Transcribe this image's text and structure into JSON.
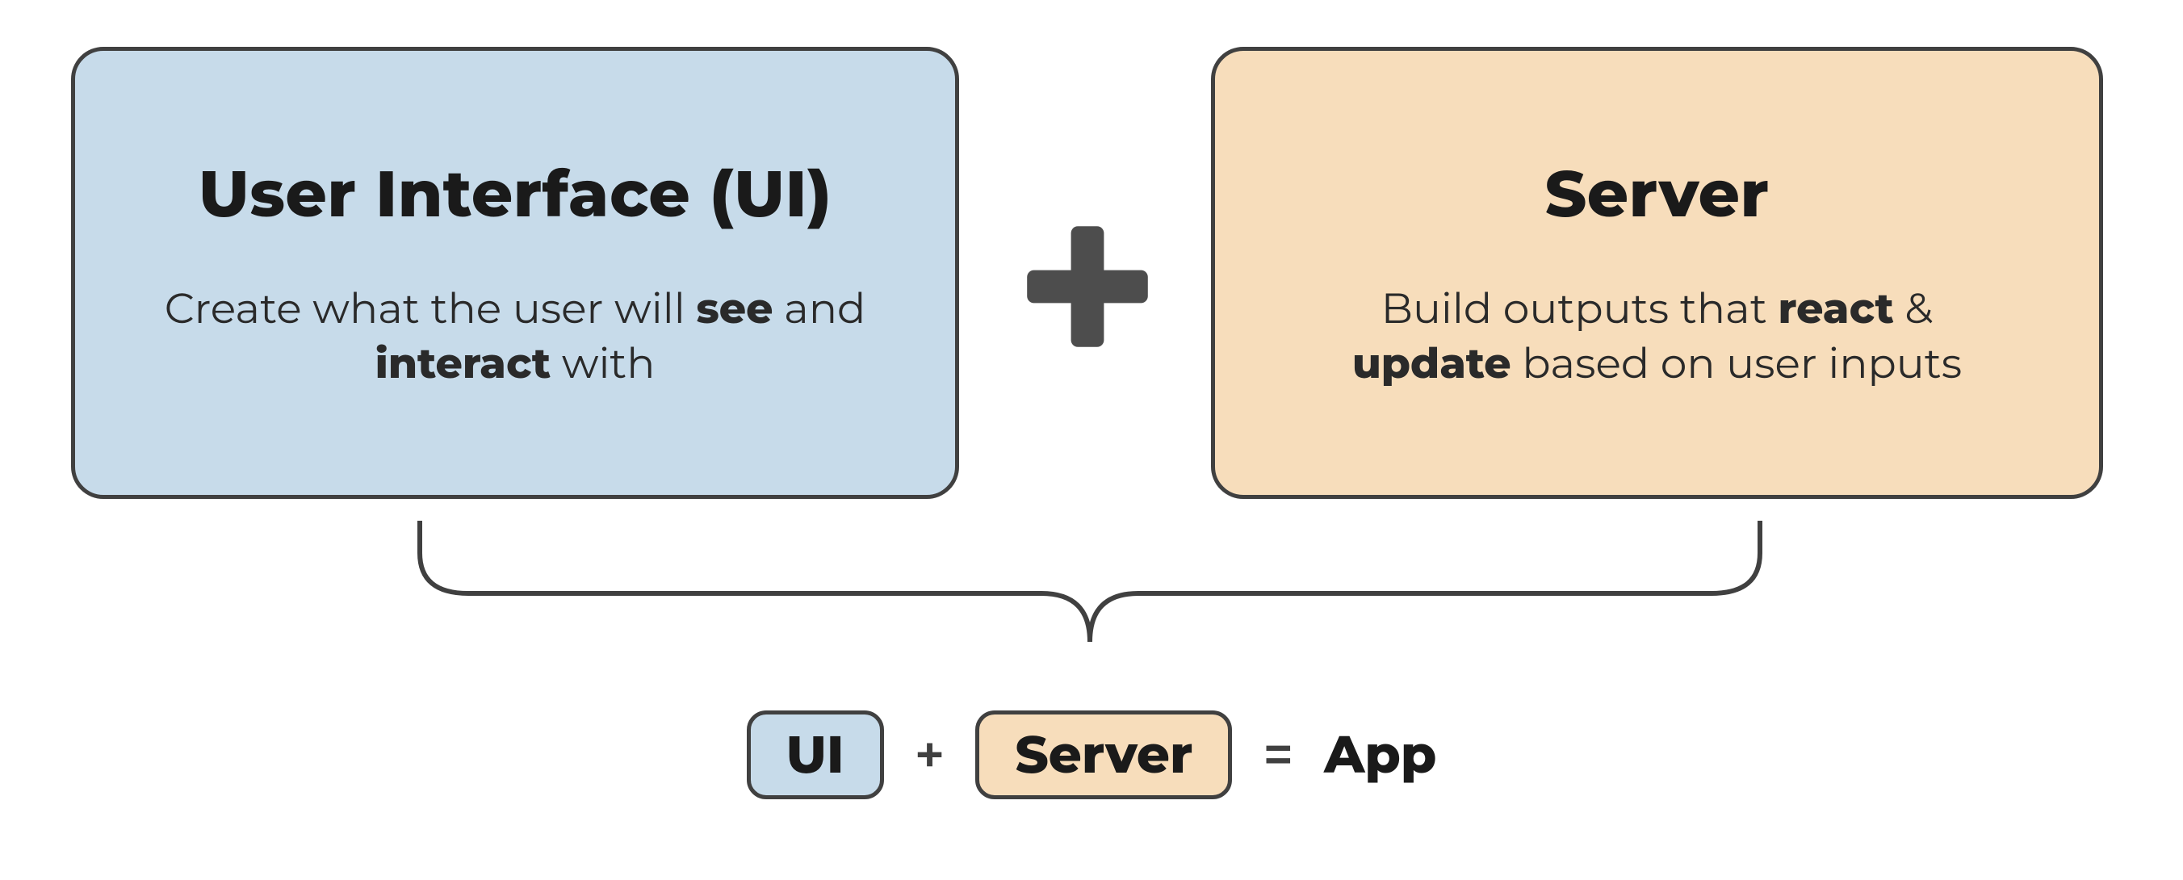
{
  "boxes": {
    "ui": {
      "title": "User Interface (UI)",
      "desc_pre": "Create what the user will ",
      "desc_b1": "see",
      "desc_mid": " and ",
      "desc_b2": "interact",
      "desc_post": " with"
    },
    "server": {
      "title": "Server",
      "desc_pre": "Build outputs that ",
      "desc_b1": "react",
      "desc_mid": " & ",
      "desc_b2": "update",
      "desc_post": " based on user inputs"
    }
  },
  "equation": {
    "ui_label": "UI",
    "plus": "+",
    "server_label": "Server",
    "equals": "=",
    "result": "App"
  },
  "colors": {
    "ui_bg": "#c7dbea",
    "server_bg": "#f7ddbb",
    "border": "#404040",
    "plus_icon": "#4d4d4d"
  }
}
